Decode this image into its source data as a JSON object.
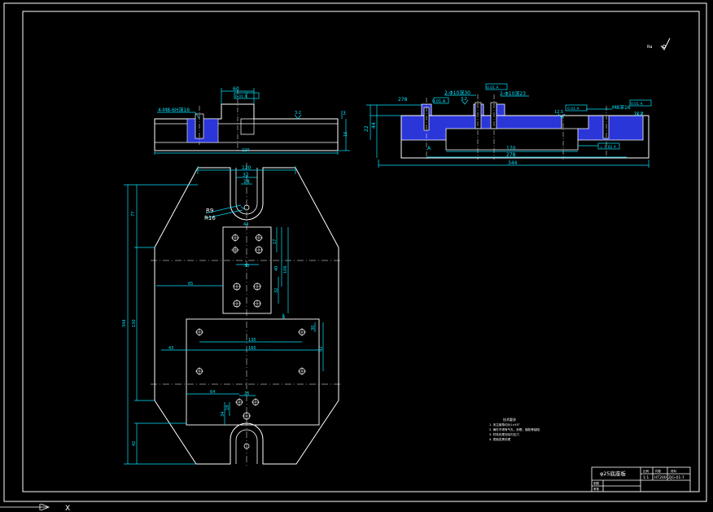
{
  "colors": {
    "background": "#000000",
    "frame": "#ffffff",
    "outline": "#ffffff",
    "dimension": "#00e5ff",
    "hatch": "#2a36d8",
    "center": "#ffffff",
    "callout_text": "#ffffff"
  },
  "roughness": {
    "mark": "Ra",
    "symbol": "check-icon"
  },
  "top_view": {
    "slot_top_dim": "60",
    "flatness_box": "0.01 A",
    "thread_note": "4-M8-6H深16",
    "roughness_value": "3.2",
    "height_right": "3",
    "height_side": "16",
    "width_bottom": "220"
  },
  "side_view": {
    "dim_278": "278",
    "dim_1": "2-Φ10",
    "dim_2": "2-Φ10深30",
    "dim_3": "2-Φ10深23",
    "dim_4": "2-M8",
    "tol_box_1": "0.01 A",
    "tol_box_2": "0.01 A",
    "tol_box_3": "0.01 A",
    "tol_box_4": "0.01 A",
    "roughness_1": "3.2",
    "roughness_2": "12.5",
    "roughness_3": "12.5",
    "m_thread": "M8深16",
    "height_left": "22",
    "height_outer": "44",
    "inner_170": "170",
    "inner_278": "278",
    "overall_344": "344",
    "ref_a": "A",
    "datum_box": "⊥ 0.02 A"
  },
  "plan_view": {
    "width_120": "120",
    "width_32": "32",
    "width_18": "18",
    "r9": "R9",
    "r16": "R16",
    "left_77": "77",
    "left_344": "344",
    "left_130": "130",
    "left_42": "42",
    "left_65": "65",
    "left_43": "43",
    "mid_44": "44",
    "mid_17": "17",
    "mid_40": "40",
    "mid_30": "30",
    "mid_106": "106",
    "mid_32": "32",
    "mid_6": "6",
    "low_130": "130",
    "low_160": "160",
    "low_30": "30",
    "low_92": "92",
    "low_64": "64",
    "low_26": "26",
    "low_34": "34",
    "low_18": "18"
  },
  "notes": {
    "title": "技术要求",
    "lines": [
      "1. 未注倒角均为1×45°",
      "2. 铸件不得有气孔、砂眼、缩松等缺陷",
      "3. 时效处理去除内应力",
      "4. 表面发黑处理"
    ]
  },
  "title_block": {
    "part_name": "φ25底座板",
    "col_scale": "比例",
    "col_qty": "件数",
    "col_material": "材料",
    "scale": "1:1",
    "material": "HT200",
    "drawing_no": "ZJG-01-7",
    "row_draw": "制图",
    "row_check": "审核"
  },
  "ucs": {
    "label": "X"
  }
}
